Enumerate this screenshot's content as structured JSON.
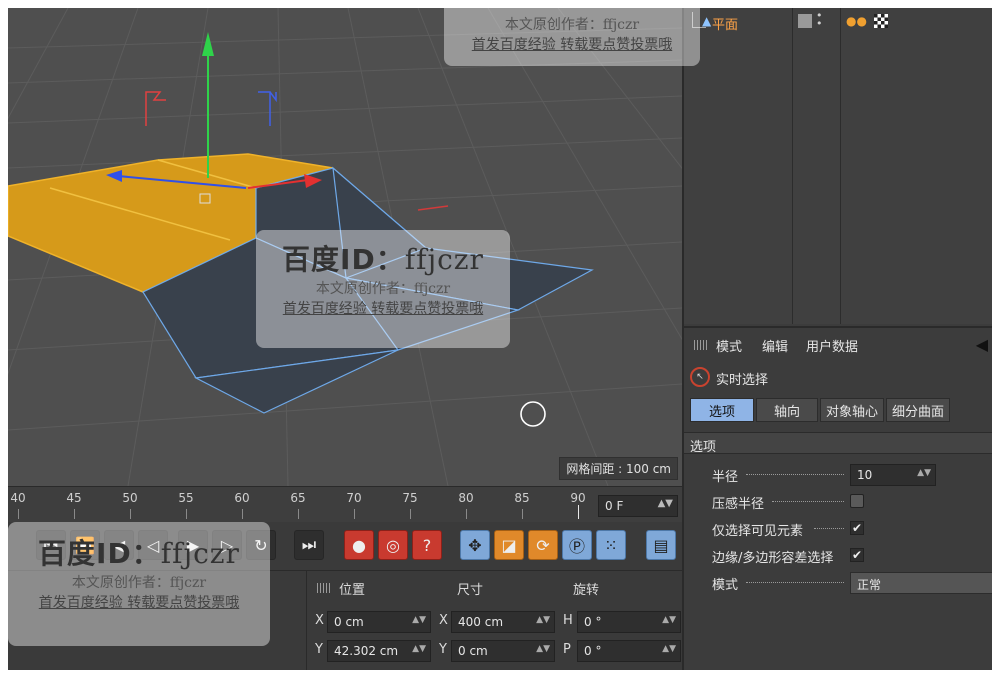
{
  "viewport": {
    "grid_spacing_label": "网格间距 : 100 cm"
  },
  "timeline": {
    "ticks": [
      "40",
      "45",
      "50",
      "55",
      "60",
      "65",
      "70",
      "75",
      "80",
      "85",
      "90"
    ],
    "current_frame": "0 F"
  },
  "coordinates": {
    "headers": {
      "position": "位置",
      "size": "尺寸",
      "rotation": "旋转"
    },
    "rows": [
      {
        "pos_axis": "X",
        "pos_value": "0 cm",
        "size_axis": "X",
        "size_value": "400 cm",
        "rot_axis": "H",
        "rot_value": "0 °"
      },
      {
        "pos_axis": "Y",
        "pos_value": "42.302 cm",
        "size_axis": "Y",
        "size_value": "0 cm",
        "rot_axis": "P",
        "rot_value": "0 °"
      }
    ]
  },
  "object_manager": {
    "object_name": "平面"
  },
  "attributes": {
    "menu": {
      "mode": "模式",
      "edit": "编辑",
      "user_data": "用户数据"
    },
    "tool_name": "实时选择",
    "tabs": [
      "选项",
      "轴向",
      "对象轴心",
      "细分曲面"
    ],
    "section_title": "选项",
    "params": {
      "radius_label": "半径",
      "radius_value": "10",
      "pressure_label": "压感半径",
      "visible_only_label": "仅选择可见元素",
      "tolerance_label": "边缘/多边形容差选择",
      "mode_label": "模式",
      "mode_value": "正常"
    }
  },
  "watermark": {
    "title_prefix": "百度ID：",
    "title_id": "ffjczr",
    "line2": "本文原创作者：ffjczr",
    "line3": "首发百度经验 转载要点赞投票哦"
  },
  "colors": {
    "selection_fill": "#d69a1a",
    "polygon_fill": "#39414c",
    "edge_highlight": "#6ea8e8",
    "accent_tab": "#8fb4e6",
    "record_red": "#c93a2f"
  }
}
